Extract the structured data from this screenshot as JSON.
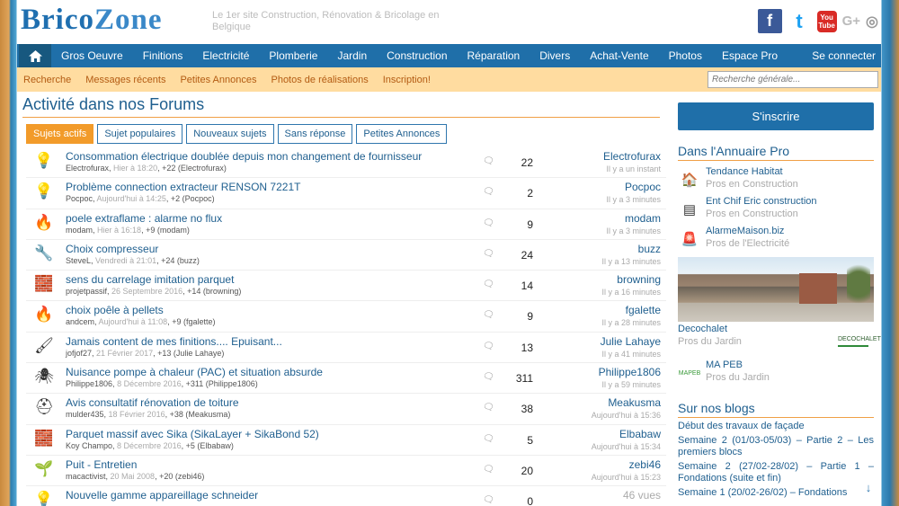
{
  "header": {
    "logo_part1": "Brico",
    "logo_part2": "Zone",
    "tagline": "Le 1er site Construction, Rénovation & Bricolage en Belgique",
    "social": [
      "f",
      "t",
      "You Tube",
      "G+",
      "◎"
    ]
  },
  "nav": {
    "items": [
      "Gros Oeuvre",
      "Finitions",
      "Electricité",
      "Plomberie",
      "Jardin",
      "Construction",
      "Réparation",
      "Divers",
      "Achat-Vente",
      "Photos",
      "Espace Pro"
    ],
    "login": "Se connecter"
  },
  "subnav": {
    "items": [
      "Recherche",
      "Messages récents",
      "Petites Annonces",
      "Photos de réalisations",
      "Inscription!"
    ],
    "search_placeholder": "Recherche générale..."
  },
  "main": {
    "title": "Activité dans nos Forums",
    "tabs": [
      "Sujets actifs",
      "Sujet populaires",
      "Nouveaux sujets",
      "Sans réponse",
      "Petites Annonces"
    ],
    "threads": [
      {
        "icon": "💡",
        "title": "Consommation électrique doublée depuis mon changement de fournisseur",
        "author": "Electrofurax",
        "date": "Hier à 18:20",
        "extra": "+22 (Electrofurax)",
        "count": "22",
        "last_user": "Electrofurax",
        "last_time": "Il y a un instant"
      },
      {
        "icon": "💡",
        "title": "Problème connection extracteur RENSON 7221T",
        "author": "Pocpoc",
        "date": "Aujourd'hui à 14:25",
        "extra": "+2 (Pocpoc)",
        "count": "2",
        "last_user": "Pocpoc",
        "last_time": "Il y a 3 minutes"
      },
      {
        "icon": "🔥",
        "title": "poele extraflame : alarme no flux",
        "author": "modam",
        "date": "Hier à 16:18",
        "extra": "+9 (modam)",
        "count": "9",
        "last_user": "modam",
        "last_time": "Il y a 3 minutes"
      },
      {
        "icon": "🔧",
        "title": "Choix compresseur",
        "author": "SteveL",
        "date": "Vendredi à 21:01",
        "extra": "+24 (buzz)",
        "count": "24",
        "last_user": "buzz",
        "last_time": "Il y a 13 minutes"
      },
      {
        "icon": "🧱",
        "title": "sens du carrelage imitation parquet",
        "author": "projetpassif",
        "date": "26 Septembre 2016",
        "extra": "+14 (browning)",
        "count": "14",
        "last_user": "browning",
        "last_time": "Il y a 16 minutes"
      },
      {
        "icon": "🔥",
        "title": "choix poêle à pellets",
        "author": "andcem",
        "date": "Aujourd'hui à 11:08",
        "extra": "+9 (fgalette)",
        "count": "9",
        "last_user": "fgalette",
        "last_time": "Il y a 28 minutes"
      },
      {
        "icon": "🖌",
        "title": "Jamais content de mes finitions.... Epuisant...",
        "author": "jofjof27",
        "date": "21 Février 2017",
        "extra": "+13 (Julie Lahaye)",
        "count": "13",
        "last_user": "Julie Lahaye",
        "last_time": "Il y a 41 minutes"
      },
      {
        "icon": "🕷",
        "title": "Nuisance pompe à chaleur (PAC) et situation absurde",
        "author": "Philippe1806",
        "date": "8 Décembre 2016",
        "extra": "+311 (Philippe1806)",
        "count": "311",
        "last_user": "Philippe1806",
        "last_time": "Il y a 59 minutes"
      },
      {
        "icon": "⛑",
        "title": "Avis consultatif rénovation de toiture",
        "author": "mulder435",
        "date": "18 Février 2016",
        "extra": "+38 (Meakusma)",
        "count": "38",
        "last_user": "Meakusma",
        "last_time": "Aujourd'hui à 15:36"
      },
      {
        "icon": "🧱",
        "title": "Parquet massif avec Sika (SikaLayer + SikaBond 52)",
        "author": "Koy Champo",
        "date": "8 Décembre 2016",
        "extra": "+5 (Elbabaw)",
        "count": "5",
        "last_user": "Elbabaw",
        "last_time": "Aujourd'hui à 15:34"
      },
      {
        "icon": "🌱",
        "title": "Puit - Entretien",
        "author": "macactivist",
        "date": "20 Mai 2008",
        "extra": "+20 (zebi46)",
        "count": "20",
        "last_user": "zebi46",
        "last_time": "Aujourd'hui à 15:23"
      },
      {
        "icon": "💡",
        "title": "Nouvelle gamme appareillage schneider",
        "author": "",
        "date": "",
        "extra": "",
        "count": "0",
        "last_user": "46 vues",
        "last_time": ""
      }
    ]
  },
  "sidebar": {
    "signup": "S'inscrire",
    "annuaire_title": "Dans l'Annuaire Pro",
    "pros": [
      {
        "logo": "🏠",
        "name": "Tendance Habitat",
        "cat": "Pros en Construction"
      },
      {
        "logo": "▤",
        "name": "Ent Chif Eric construction",
        "cat": "Pros en Construction"
      },
      {
        "logo": "🚨",
        "name": "AlarmeMaison.biz",
        "cat": "Pros de l'Electricité"
      }
    ],
    "featured": {
      "name": "Decochalet",
      "cat": "Pros du Jardin",
      "logo": "DECOCHALET"
    },
    "mapeb": {
      "logo": "MAPEB",
      "name": "MA PEB",
      "cat": "Pros du Jardin"
    },
    "blogs_title": "Sur nos blogs",
    "blogs": [
      "Début des travaux de façade",
      "Semaine 2 (01/03-05/03) – Partie 2 – Les premiers blocs",
      "Semaine 2 (27/02-28/02) – Partie 1 – Fondations (suite et fin)",
      "Semaine 1 (20/02-26/02) – Fondations"
    ]
  }
}
